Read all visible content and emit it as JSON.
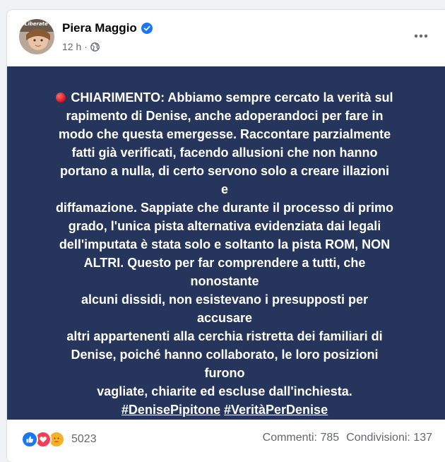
{
  "post": {
    "author": "Piera Maggio",
    "avatar_text": "#Liberate Denise",
    "time": "12 h",
    "dot": "·",
    "privacy_icon": "globe-icon",
    "verified_icon": "verified-badge-icon",
    "more_icon": "more-options-icon",
    "background_color": "#26355c",
    "text_lines": [
      "CHIARIMENTO: Abbiamo sempre cercato la verità sul",
      "rapimento di Denise, anche adoperandoci per fare in",
      "modo che questa emergesse. Raccontare parzialmente",
      "fatti già verificati, facendo allusioni che non hanno",
      "portano a nulla, di certo servono solo a creare illazioni e",
      "diffamazione. Sappiate che durante il processo di primo",
      "grado, l'unica pista alternativa evidenziata dai legali",
      "dell'imputata è stata solo e soltanto la pista ROM, NON",
      "ALTRI. Questo per far comprendere a tutti, che nonostante",
      "alcuni dissidi, non esistevano i presupposti per accusare",
      "altri appartenenti alla cerchia ristretta dei familiari di",
      "Denise, poiché hanno collaborato, le loro posizioni furono",
      "vagliate, chiarite ed escluse dall'inchiesta."
    ],
    "hashtags": [
      "#DenisePipitone",
      "#VeritàPerDenise"
    ]
  },
  "footer": {
    "reaction_icons": [
      "like-icon",
      "love-icon",
      "care-icon"
    ],
    "reaction_count": "5023",
    "comments": "Commenti: 785",
    "shares": "Condivisioni: 137"
  }
}
